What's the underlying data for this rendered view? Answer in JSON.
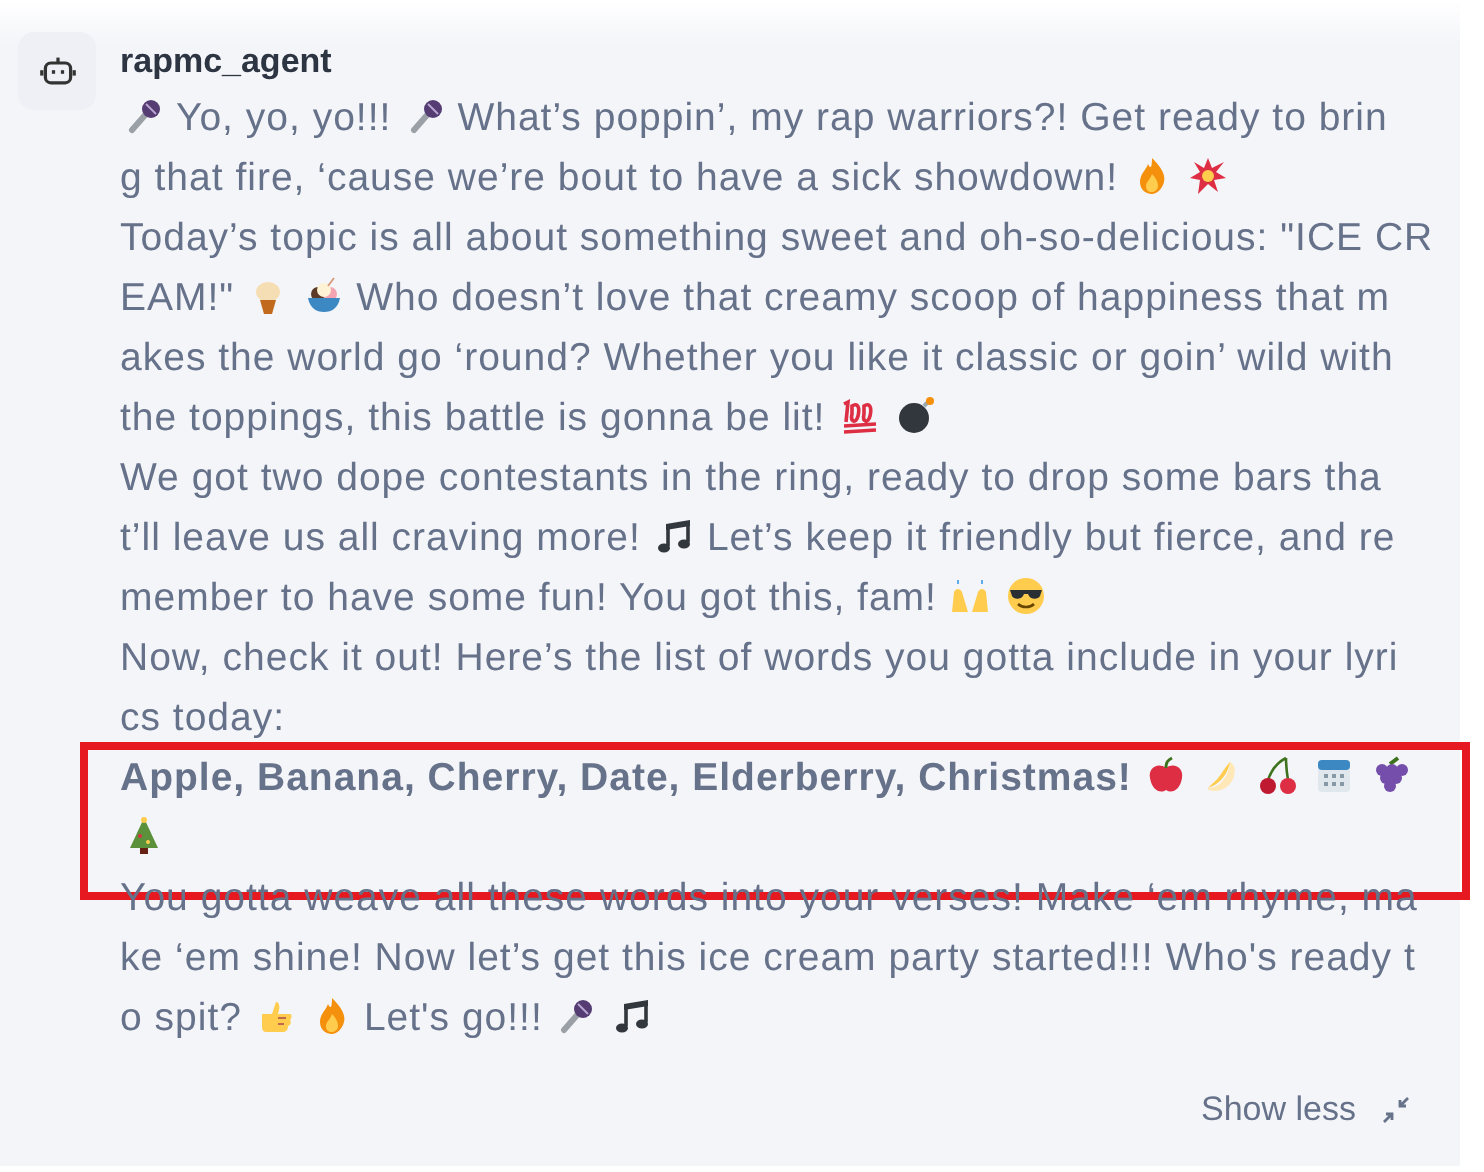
{
  "message": {
    "author": "rapmc_agent",
    "paragraphs": [
      {
        "bold": false,
        "lines": [
          [
            {
              "kind": "icon"
            },
            {
              "kind": "text",
              "text": "Yo, yo, yo!!!"
            },
            {
              "kind": "icon"
            },
            {
              "kind": "text",
              "text": "What’s poppin’, my rap warriors?! Get ready to brin"
            }
          ],
          [
            {
              "kind": "text",
              "text": "g that fire, ‘cause we’re bout to have a sick showdown!"
            },
            {
              "kind": "icon"
            },
            {
              "kind": "icon"
            }
          ]
        ]
      },
      {
        "bold": false,
        "lines": [
          [
            {
              "kind": "text",
              "text": "Today’s topic is all about something sweet and oh-so-delicious: \"ICE CR"
            }
          ],
          [
            {
              "kind": "text",
              "text": "EAM!\""
            },
            {
              "kind": "icon"
            },
            {
              "kind": "icon"
            },
            {
              "kind": "text",
              "text": "Who doesn’t love that creamy scoop of happiness that m"
            }
          ],
          [
            {
              "kind": "text",
              "text": "akes the world go ‘round? Whether you like it classic or goin’ wild with"
            }
          ],
          [
            {
              "kind": "text",
              "text": "the toppings, this battle is gonna be lit!"
            },
            {
              "kind": "icon"
            },
            {
              "kind": "icon"
            }
          ]
        ]
      },
      {
        "bold": false,
        "lines": [
          [
            {
              "kind": "text",
              "text": "We got two dope contestants in the ring, ready to drop some bars tha"
            }
          ],
          [
            {
              "kind": "text",
              "text": "t’ll leave us all craving more!"
            },
            {
              "kind": "icon"
            },
            {
              "kind": "text",
              "text": "Let’s keep it friendly but fierce, and re"
            }
          ],
          [
            {
              "kind": "text",
              "text": "member to have some fun! You got this, fam!"
            },
            {
              "kind": "icon"
            },
            {
              "kind": "icon"
            }
          ]
        ]
      },
      {
        "bold": false,
        "lines": [
          [
            {
              "kind": "text",
              "text": "Now, check it out! Here’s the list of words you gotta include in your lyri"
            }
          ],
          [
            {
              "kind": "text",
              "text": "cs today:"
            }
          ]
        ]
      },
      {
        "bold": true,
        "highlighted": true,
        "lines": [
          [
            {
              "kind": "text",
              "text": "Apple, Banana, Cherry, Date, Elderberry, Christmas!"
            },
            {
              "kind": "icon"
            },
            {
              "kind": "icon"
            },
            {
              "kind": "icon"
            },
            {
              "kind": "icon"
            },
            {
              "kind": "icon"
            }
          ],
          [
            {
              "kind": "icon"
            }
          ]
        ]
      },
      {
        "bold": false,
        "lines": [
          [
            {
              "kind": "text",
              "text": "You gotta weave all these words into your verses! Make ‘em rhyme, ma"
            }
          ],
          [
            {
              "kind": "text",
              "text": "ke ‘em shine! Now let’s get this ice cream party started!!! Who's ready t"
            }
          ],
          [
            {
              "kind": "text",
              "text": "o spit?"
            },
            {
              "kind": "icon"
            },
            {
              "kind": "icon"
            },
            {
              "kind": "text",
              "text": "Let's go!!!"
            },
            {
              "kind": "icon"
            },
            {
              "kind": "icon"
            }
          ]
        ]
      }
    ],
    "toggle": {
      "label": "Show less"
    }
  }
}
